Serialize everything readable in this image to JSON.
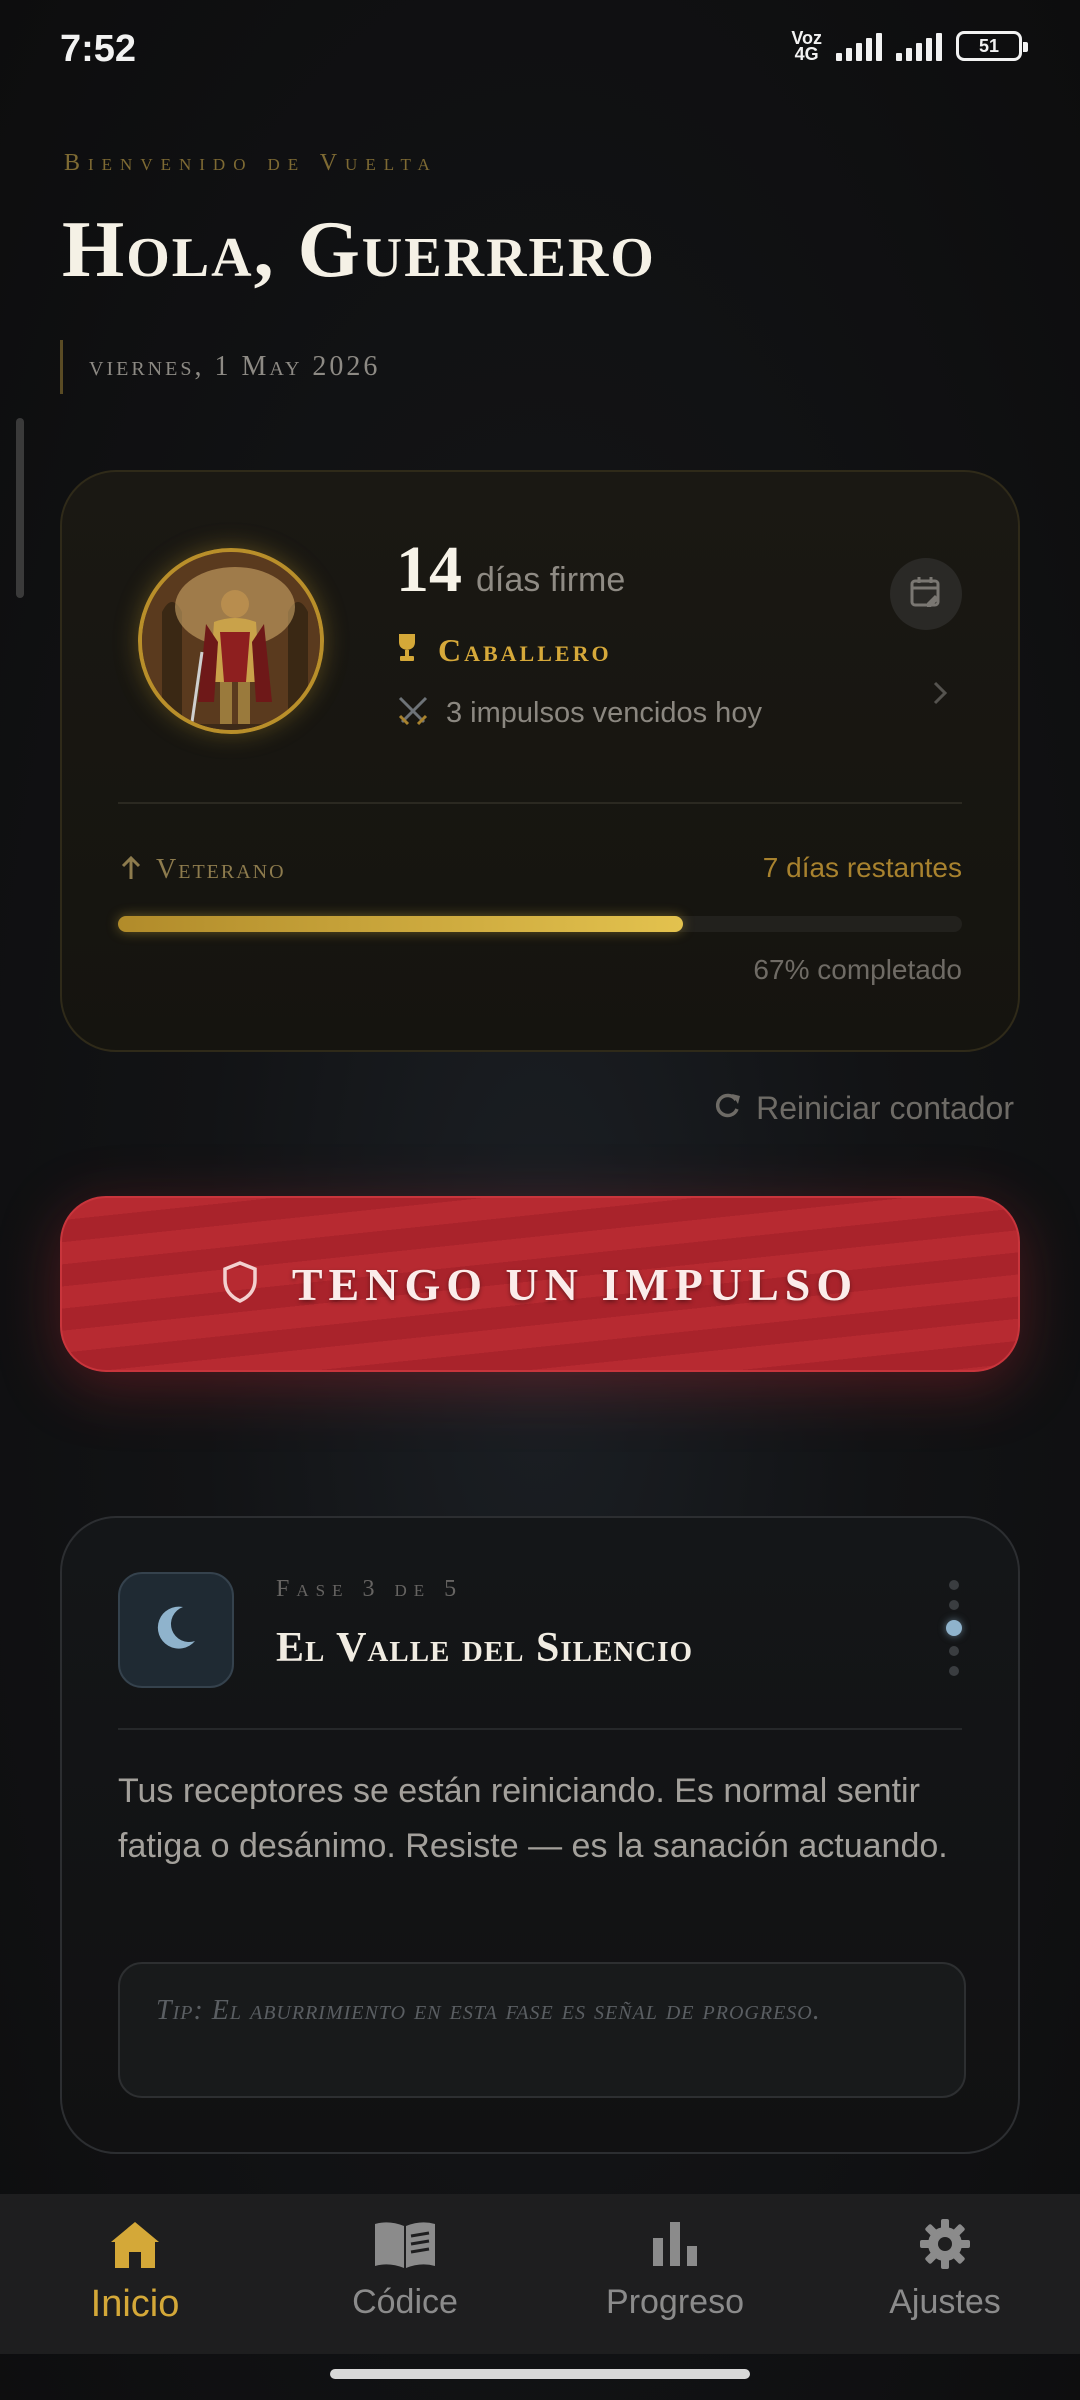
{
  "status_bar": {
    "time": "7:52",
    "network_top": "Voz",
    "network_bottom": "4G",
    "battery": "51"
  },
  "header": {
    "welcome": "Bienvenido de Vuelta",
    "greeting": "Hola, Guerrero",
    "date": "viernes, 1 May 2026"
  },
  "streak": {
    "days": "14",
    "days_label": "días firme",
    "rank": "Caballero",
    "urges_defeated": "3 impulsos vencidos hoy",
    "next_rank": "Veterano",
    "remaining": "7 días restantes",
    "progress_fraction": 0.67,
    "completed": "67% completado"
  },
  "reset": {
    "label": "Reiniciar contador"
  },
  "urge_button": {
    "label": "TENGO UN IMPULSO"
  },
  "phase": {
    "step": "Fase 3 de 5",
    "title": "El Valle del Silencio",
    "description": "Tus receptores se están reiniciando. Es normal sentir fatiga o desánimo. Resiste — es la sanación actuando.",
    "tip": "Tip: El aburrimiento en esta fase es señal de progreso.",
    "icon": "moon-icon"
  },
  "nav": {
    "items": [
      {
        "label": "Inicio",
        "icon": "home-icon",
        "active": true
      },
      {
        "label": "Códice",
        "icon": "book-icon",
        "active": false
      },
      {
        "label": "Progreso",
        "icon": "bar-chart-icon",
        "active": false
      },
      {
        "label": "Ajustes",
        "icon": "gear-icon",
        "active": false
      }
    ]
  },
  "colors": {
    "gold": "#d4a838",
    "urge_red": "#b72a31",
    "background": "#121315",
    "phase_accent": "#8fb3cc"
  }
}
